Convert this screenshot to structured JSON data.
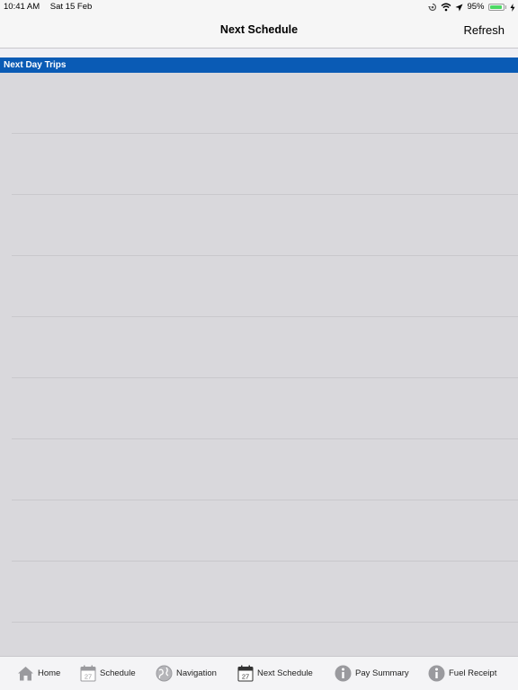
{
  "status_bar": {
    "time": "10:41 AM",
    "date": "Sat 15 Feb",
    "battery": "95%",
    "battery_level": 0.95,
    "battery_color": "#4cd964"
  },
  "nav": {
    "title": "Next Schedule",
    "refresh": "Refresh"
  },
  "section": {
    "header": "Next Day Trips",
    "color": "#0a5bb5",
    "rows": [
      "",
      "",
      "",
      "",
      "",
      "",
      "",
      "",
      "",
      ""
    ]
  },
  "tabs": [
    {
      "label": "Home",
      "icon": "home-icon"
    },
    {
      "label": "Schedule",
      "icon": "calendar-icon",
      "day": "27"
    },
    {
      "label": "Navigation",
      "icon": "globe-icon"
    },
    {
      "label": "Next Schedule",
      "icon": "calendar-icon",
      "day": "27"
    },
    {
      "label": "Pay Summary",
      "icon": "info-icon"
    },
    {
      "label": "Fuel Receipt",
      "icon": "info-icon"
    }
  ]
}
